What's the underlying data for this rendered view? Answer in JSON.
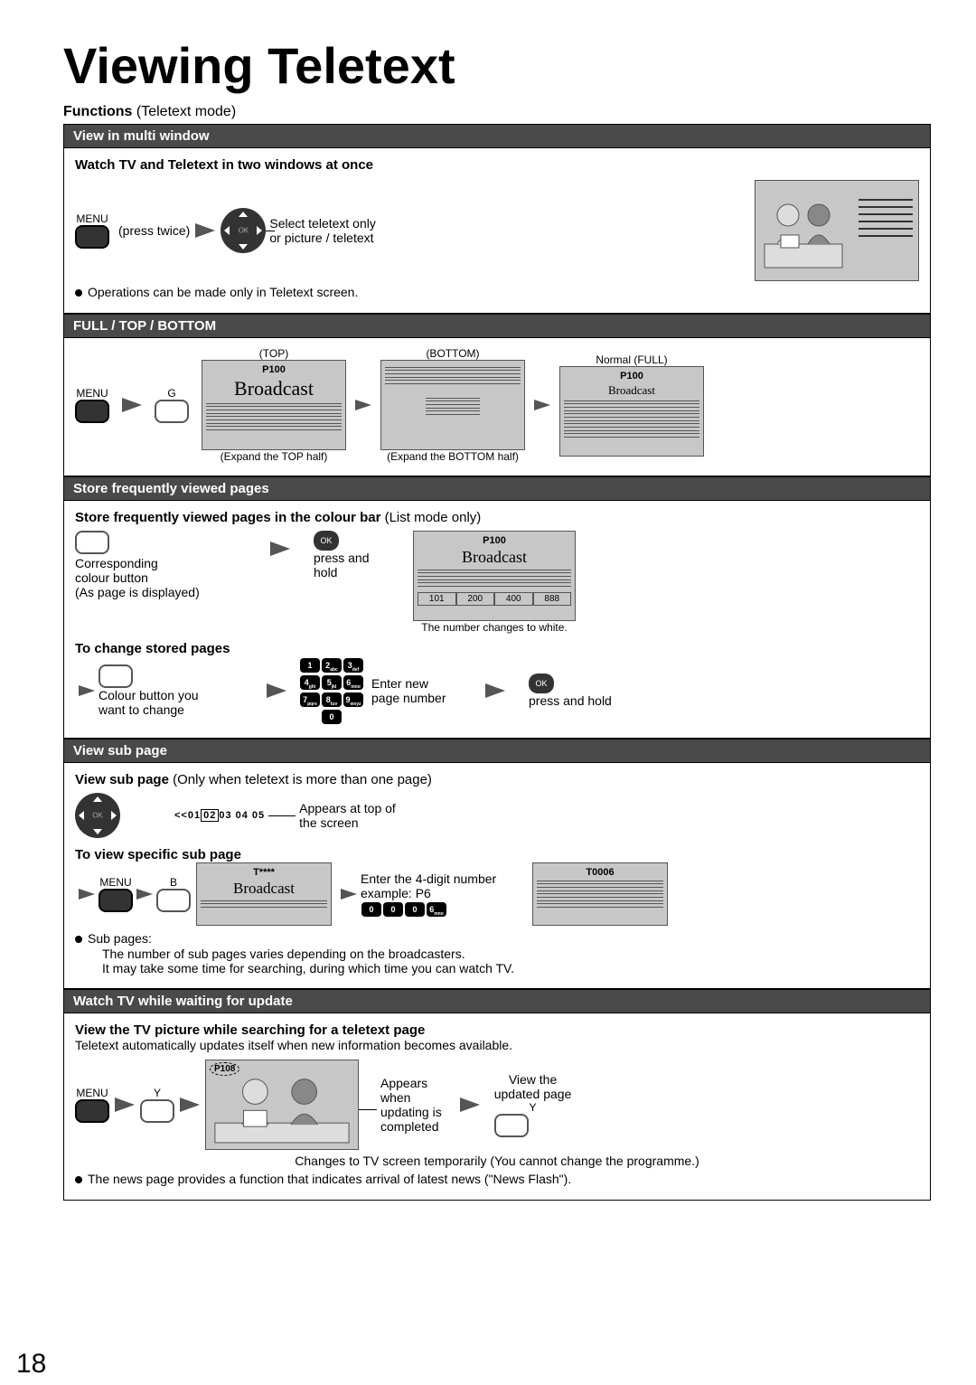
{
  "title": "Viewing Teletext",
  "functions_label": "Functions",
  "functions_mode": "(Teletext mode)",
  "page_number": "18",
  "s1": {
    "header": "View in multi window",
    "watch": "Watch TV and Teletext in two windows at once",
    "menu": "MENU",
    "press_twice": "(press twice)",
    "select1": "Select teletext only",
    "select2": "or picture / teletext",
    "note": "Operations can be made only in Teletext screen."
  },
  "s2": {
    "header": "FULL / TOP / BOTTOM",
    "menu": "MENU",
    "g": "G",
    "top": "(TOP)",
    "bottom": "(BOTTOM)",
    "normal": "Normal (FULL)",
    "p100": "P100",
    "broadcast": "Broadcast",
    "expand_top": "(Expand the TOP half)",
    "expand_bottom": "(Expand the BOTTOM half)"
  },
  "s3": {
    "header": "Store frequently viewed pages",
    "intro_b": "Store frequently viewed pages in the colour bar",
    "intro_n": " (List mode only)",
    "corr1": "Corresponding",
    "corr2": "colour button",
    "corr3": "(As page is displayed)",
    "press_hold": "press and\nhold",
    "ok": "OK",
    "p100": "P100",
    "broadcast": "Broadcast",
    "cbar": [
      "101",
      "200",
      "400",
      "888"
    ],
    "num_changes": "The number changes to white.",
    "to_change": "To change stored pages",
    "colb1": "Colour button you",
    "colb2": "want to change",
    "enter1": "Enter new",
    "enter2": "page number",
    "press_hold2": "press and hold"
  },
  "s4": {
    "header": "View sub page",
    "intro_b": "View sub page",
    "intro_n": " (Only when teletext is more than one page)",
    "subbar_pre": "<<01",
    "subbar_hl": "02",
    "subbar_post": "03 04 05",
    "appears": "Appears at top of\nthe screen",
    "to_view": "To view specific sub page",
    "menu": "MENU",
    "b": "B",
    "tstar": "T****",
    "broadcast": "Broadcast",
    "enter4": "Enter the 4-digit number",
    "example": "example: P6",
    "t0006": "T0006",
    "subpages": "Sub pages:",
    "note1": "The number of sub pages varies depending on the broadcasters.",
    "note2": "It may take some time for searching, during which time you can watch TV."
  },
  "s5": {
    "header": "Watch TV while waiting for update",
    "intro_b": "View the TV picture while searching for a teletext page",
    "intro_n": "Teletext automatically updates itself when new information becomes available.",
    "menu": "MENU",
    "y": "Y",
    "p108": "P108",
    "appears": "Appears\nwhen\nupdating is\ncompleted",
    "view_updated": "View the\nupdated page",
    "changes": "Changes to TV screen temporarily (You cannot change the programme.)",
    "news": "The news page provides a function that indicates arrival of latest news (\"News Flash\")."
  }
}
